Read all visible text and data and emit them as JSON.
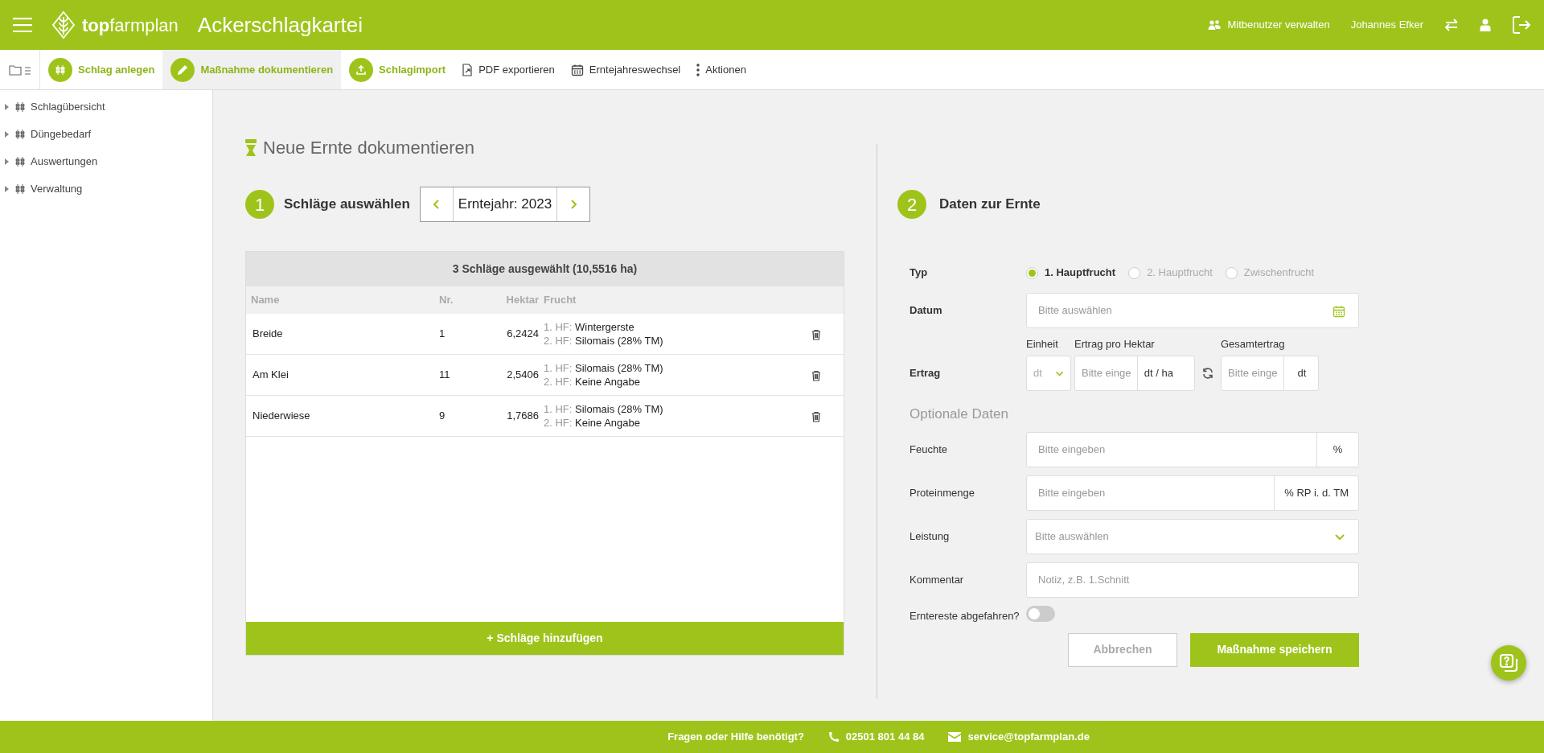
{
  "header": {
    "logo": "**top**farmplan",
    "title": "Ackerschlagkartei",
    "user_links": [
      {
        "kind": "users",
        "label": "Mitbenutzer verwalten"
      },
      {
        "kind": "plain",
        "label": "Johannes Efker"
      }
    ]
  },
  "toolbar": [
    {
      "kind": "circle",
      "label": "Schlag anlegen",
      "selected": false
    },
    {
      "kind": "circle",
      "label": "Maßnahme dokumentieren",
      "selected": true
    },
    {
      "kind": "circle",
      "label": "Schlagimport",
      "selected": false
    },
    {
      "kind": "plain",
      "label": "PDF exportieren",
      "selected": false
    },
    {
      "kind": "plain",
      "label": "Erntejahreswechsel",
      "selected": false
    },
    {
      "kind": "plain",
      "label": "Aktionen",
      "selected": false
    }
  ],
  "sidebar": {
    "items": [
      {
        "label": "Schlagübersicht",
        "expanded": false
      },
      {
        "label": "Düngebedarf",
        "expanded": false
      },
      {
        "label": "Auswertungen",
        "expanded": false
      },
      {
        "label": "Verwaltung",
        "expanded": false
      }
    ]
  },
  "page_title": "Neue Ernte dokumentieren",
  "step1": {
    "number": "1",
    "title": "Schläge auswählen",
    "year": "Erntejahr: 2023"
  },
  "table": {
    "summary": "3 Schläge ausgewählt (10,5516 ha)",
    "columns": [
      "Name",
      "Nr.",
      "Hektar",
      "Frucht"
    ],
    "rows": [
      {
        "name": "Breide",
        "nr": "1",
        "hektar": "6,2424",
        "crops": [
          {
            "label": "1. HF:",
            "value": "Wintergerste"
          },
          {
            "label": "2. HF:",
            "value": "Silomais (28% TM)"
          }
        ]
      },
      {
        "name": "Am Klei",
        "nr": "11",
        "hektar": "2,5406",
        "crops": [
          {
            "label": "1. HF:",
            "value": "Silomais (28% TM)"
          },
          {
            "label": "2. HF:",
            "value": "Keine Angabe"
          }
        ]
      },
      {
        "name": "Niederwiese",
        "nr": "9",
        "hektar": "1,7686",
        "crops": [
          {
            "label": "1. HF:",
            "value": "Silomais (28% TM)"
          },
          {
            "label": "2. HF:",
            "value": "Keine Angabe"
          }
        ]
      }
    ],
    "add_button": "+ Schläge hinzufügen"
  },
  "step2": {
    "number": "2",
    "title": "Daten zur Ernte"
  },
  "form": {
    "typ": {
      "label": "Typ",
      "options": [
        {
          "label": "1. Hauptfrucht",
          "selected": true
        },
        {
          "label": "2. Hauptfrucht",
          "selected": false
        },
        {
          "label": "Zwischenfrucht",
          "selected": false
        }
      ]
    },
    "datum": {
      "label": "Datum",
      "placeholder": "Bitte auswählen"
    },
    "ertrag": {
      "label": "Ertrag",
      "unit_select": {
        "label": "Einheit",
        "placeholder": "dt"
      },
      "per_hectare": {
        "label": "Ertrag pro Hektar",
        "placeholder": "Bitte einge",
        "unit": "dt / ha"
      },
      "total": {
        "label": "Gesamtertrag",
        "placeholder": "Bitte einge",
        "unit": "dt"
      }
    },
    "optional_heading": "Optionale Daten",
    "optional_fields": [
      {
        "kind": "unit",
        "label": "Feuchte",
        "placeholder": "Bitte eingeben",
        "unit": "%"
      },
      {
        "kind": "unit",
        "label": "Proteinmenge",
        "placeholder": "Bitte eingeben",
        "unit": "% RP i. d. TM"
      },
      {
        "kind": "select",
        "label": "Leistung",
        "placeholder": "Bitte auswählen"
      },
      {
        "kind": "text",
        "label": "Kommentar",
        "placeholder": "Notiz, z.B. 1.Schnitt"
      }
    ],
    "toggle": {
      "label": "Erntereste abgefahren?",
      "on": false
    },
    "buttons": {
      "cancel": "Abbrechen",
      "save": "Maßnahme speichern"
    }
  },
  "footer": {
    "question": "Fragen oder Hilfe benötigt?",
    "phone": "02501 801 44 84",
    "email": "service@topfarmplan.de"
  }
}
